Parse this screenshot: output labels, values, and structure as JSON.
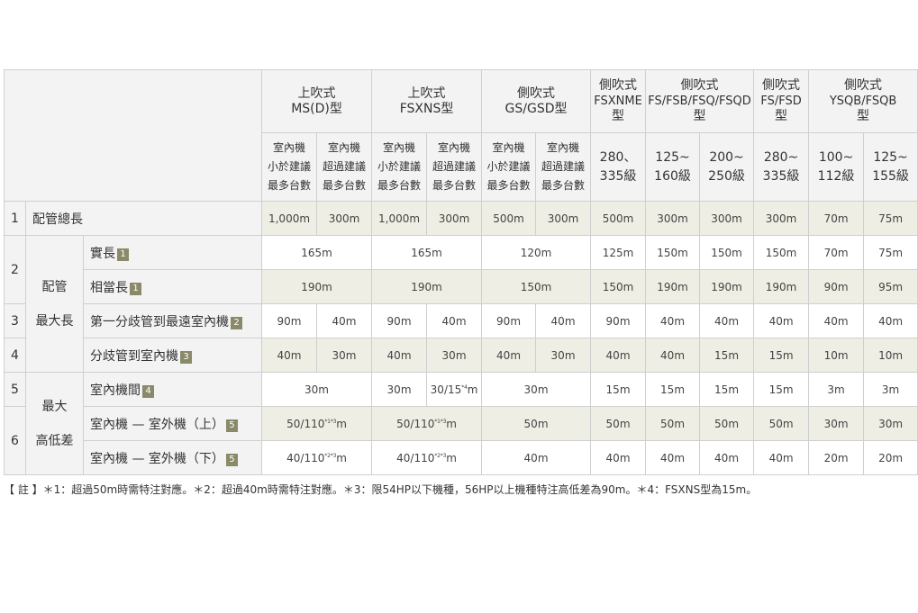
{
  "header": {
    "groups": [
      {
        "name": "上吹式",
        "sub": "MS(D)型"
      },
      {
        "name": "上吹式",
        "sub": "FSXNS型"
      },
      {
        "name": "側吹式",
        "sub": "GS/GSD型"
      },
      {
        "name": "側吹式",
        "sub": "FSXNME型"
      },
      {
        "name": "側吹式",
        "sub": "FS/FSB/FSQ/FSQD型"
      },
      {
        "name": "側吹式",
        "sub": "FS/FSD型"
      },
      {
        "name": "側吹式",
        "sub": "YSQB/FSQB型"
      }
    ],
    "sub_cols": [
      {
        "l1": "室內機",
        "l2": "小於建議",
        "l3": "最多台數"
      },
      {
        "l1": "室內機",
        "l2": "超過建議",
        "l3": "最多台數"
      },
      {
        "l1": "室內機",
        "l2": "小於建議",
        "l3": "最多台數"
      },
      {
        "l1": "室內機",
        "l2": "超過建議",
        "l3": "最多台數"
      },
      {
        "l1": "室內機",
        "l2": "小於建議",
        "l3": "最多台數"
      },
      {
        "l1": "室內機",
        "l2": "超過建議",
        "l3": "最多台數"
      },
      {
        "l1": "280、",
        "l2": "335級"
      },
      {
        "l1": "125~",
        "l2": "160級"
      },
      {
        "l1": "200~",
        "l2": "250級"
      },
      {
        "l1": "280~",
        "l2": "335級"
      },
      {
        "l1": "100~",
        "l2": "112級"
      },
      {
        "l1": "125~",
        "l2": "155級"
      }
    ]
  },
  "rows": {
    "r1": {
      "num": "1",
      "label": "配管總長",
      "cells": [
        "1,000m",
        "300m",
        "1,000m",
        "300m",
        "500m",
        "300m",
        "500m",
        "300m",
        "300m",
        "300m",
        "70m",
        "75m"
      ]
    },
    "r2a": {
      "num": "2",
      "group": "配管",
      "label": "實長",
      "badge": "1",
      "cells": [
        "165m",
        "165m",
        "120m",
        "125m",
        "150m",
        "150m",
        "150m",
        "70m",
        "75m"
      ]
    },
    "r2b": {
      "label": "相當長",
      "badge": "1",
      "cells": [
        "190m",
        "190m",
        "150m",
        "150m",
        "190m",
        "190m",
        "190m",
        "90m",
        "95m"
      ]
    },
    "r3": {
      "num": "3",
      "group": "最大長",
      "label": "第一分歧管到最遠室內機",
      "badge": "2",
      "cells": [
        "90m",
        "40m",
        "90m",
        "40m",
        "90m",
        "40m",
        "90m",
        "40m",
        "40m",
        "40m",
        "40m",
        "40m"
      ]
    },
    "r4": {
      "num": "4",
      "label": "分歧管到室內機",
      "badge": "3",
      "cells": [
        "40m",
        "30m",
        "40m",
        "30m",
        "40m",
        "30m",
        "40m",
        "40m",
        "15m",
        "15m",
        "10m",
        "10m"
      ]
    },
    "r5": {
      "num": "5",
      "group": "最大",
      "label": "室內機間",
      "badge": "4",
      "c_ms": "30m",
      "c_fsxns_a": "30m",
      "c_fsxns_b": "30/15",
      "c_fsxns_b_sup": "*4",
      "c_fsxns_b_unit": "m",
      "cells": [
        "30m",
        "15m",
        "15m",
        "15m",
        "15m",
        "3m",
        "3m"
      ]
    },
    "r6a": {
      "num": "6",
      "group": "高低差",
      "label": "室內機 — 室外機（上）",
      "badge": "5",
      "c_ms": "50/110",
      "c_ms_sup": "*1*3",
      "c_fsxns": "50/110",
      "c_fsxns_sup": "*1*3",
      "unit": "m",
      "cells": [
        "50m",
        "50m",
        "50m",
        "50m",
        "50m",
        "30m",
        "30m"
      ]
    },
    "r6b": {
      "label": "室內機 — 室外機（下）",
      "badge": "5",
      "c_ms": "40/110",
      "c_ms_sup": "*2*3",
      "c_fsxns": "40/110",
      "c_fsxns_sup": "*2*3",
      "unit": "m",
      "cells": [
        "40m",
        "40m",
        "40m",
        "40m",
        "40m",
        "20m",
        "20m"
      ]
    }
  },
  "note": "【 註 】＊1：超過50m時需特注對應。＊2：超過40m時需特注對應。＊3：限54HP以下機種，56HP以上機種特注高低差為90m。＊4：FSXNS型為15m。"
}
